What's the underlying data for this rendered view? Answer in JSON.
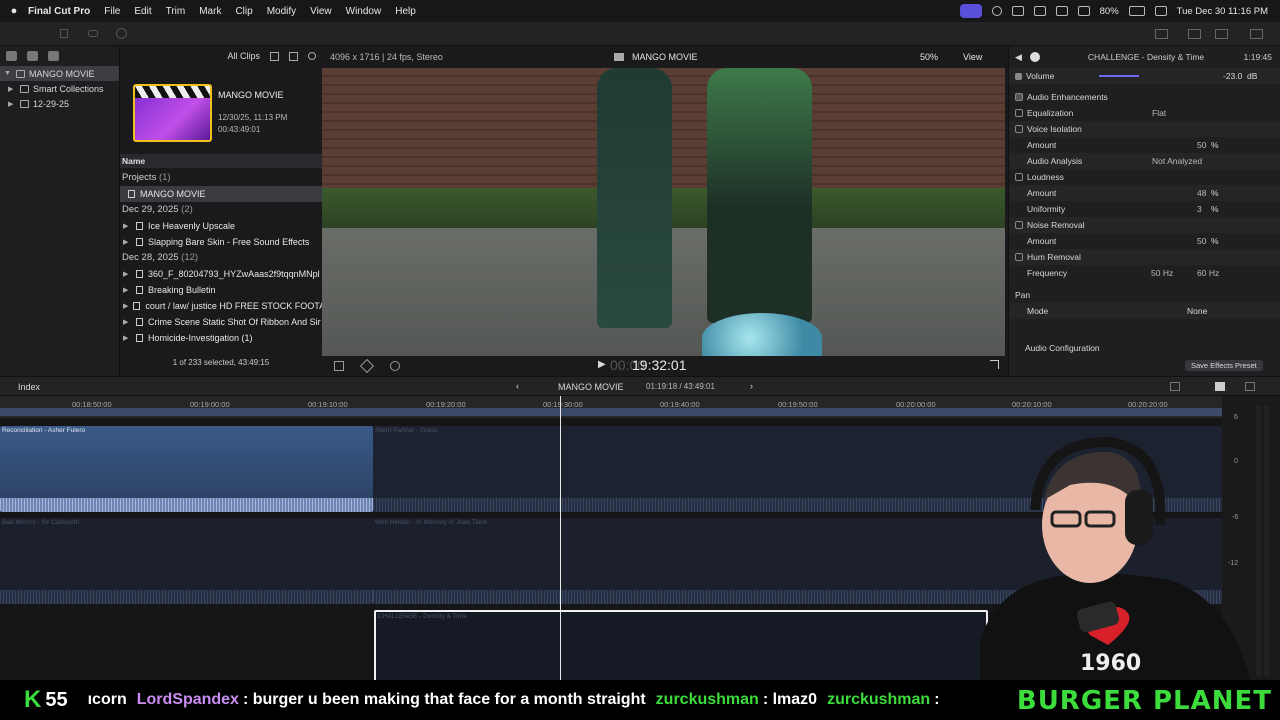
{
  "menubar": {
    "apple": "",
    "app": "Final Cut Pro",
    "items": [
      "File",
      "Edit",
      "Trim",
      "Mark",
      "Clip",
      "Modify",
      "View",
      "Window",
      "Help"
    ],
    "battery": "80%",
    "datetime": "Tue Dec 30  11:16 PM"
  },
  "library": {
    "items": [
      {
        "label": "MANGO MOVIE"
      },
      {
        "label": "Smart Collections"
      },
      {
        "label": "12-29-25"
      }
    ]
  },
  "browser": {
    "filter": "All Clips",
    "project": {
      "name": "MANGO MOVIE",
      "date": "12/30/25, 11:13 PM",
      "duration": "00:43:49:01"
    },
    "name_header": "Name",
    "groups": [
      {
        "label": "Projects",
        "count": "(1)",
        "items": [
          "MANGO MOVIE"
        ]
      },
      {
        "label": "Dec 29, 2025",
        "count": "(2)",
        "items": [
          "Ice Heavenly Upscale",
          "Slapping Bare Skin - Free Sound Effects"
        ]
      },
      {
        "label": "Dec 28, 2025",
        "count": "(12)",
        "items": [
          "360_F_80204793_HYZwAaas2f9tqqnMNpl",
          "Breaking Bulletin",
          "court / law/ justice HD FREE STOCK FOOTA",
          "Crime Scene Static Shot Of Ribbon And Sir",
          "Homicide-Investigation (1)"
        ]
      }
    ],
    "footer": "1 of 233 selected, 43:49:15"
  },
  "viewer": {
    "format": "4096 x 1716 | 24 fps, Stereo",
    "title": "MANGO MOVIE",
    "zoom": "50%",
    "view": "View",
    "timecode": "19:32:01",
    "tc_prefix": "00:00"
  },
  "inspector": {
    "title": "CHALLENGE - Density & Time",
    "time": "1:19:45",
    "volume": {
      "label": "Volume",
      "value": "-23.0",
      "unit": "dB"
    },
    "section": "Audio Enhancements",
    "rows": [
      {
        "label": "Equalization",
        "value": "Flat",
        "cb": true
      },
      {
        "label": "Voice Isolation",
        "value": "",
        "cb": true
      },
      {
        "label": "Amount",
        "value": "50",
        "unit": "%",
        "indent": true
      },
      {
        "label": "Audio Analysis",
        "value": "Not Analyzed",
        "indent": true
      },
      {
        "label": "Loudness",
        "value": "",
        "cb": true
      },
      {
        "label": "Amount",
        "value": "48",
        "unit": "%",
        "indent": true
      },
      {
        "label": "Uniformity",
        "value": "3",
        "unit": "%",
        "indent": true
      },
      {
        "label": "Noise Removal",
        "value": "",
        "cb": true
      },
      {
        "label": "Amount",
        "value": "50",
        "unit": "%",
        "indent": true
      },
      {
        "label": "Hum Removal",
        "value": "",
        "cb": true
      },
      {
        "label": "Frequency",
        "value": "50 Hz",
        "value2": "60 Hz",
        "indent": true
      }
    ],
    "pan": {
      "label": "Pan",
      "mode_label": "Mode",
      "mode_value": "None"
    },
    "config": "Audio Configuration",
    "save": "Save Effects Preset"
  },
  "timeline": {
    "index": "Index",
    "project": "MANGO MOVIE",
    "tc": "01:19:18 / 43:49:01",
    "ruler": [
      "00:18:50:00",
      "00:19:00:00",
      "00:19:10:00",
      "00:19:20:00",
      "00:19:30:00",
      "00:19:40:00",
      "00:19:50:00",
      "00:20:00:00",
      "00:20:10:00",
      "00:20:20:00"
    ],
    "clips": [
      "Reconciliation - Asher Fulero",
      "Silent Partner - Grass",
      "Bad Mirrors - Sir Cubworth",
      "Wim Heiden - In Memory of Jean Talon",
      "CHALLENGE - Density & Time"
    ],
    "meter_labels": [
      "6",
      "0",
      "-6",
      "-12"
    ]
  },
  "ticker": {
    "k": "K",
    "count": "55",
    "messages": [
      {
        "user": "ıcorn",
        "text": "",
        "color": "#ffffff"
      },
      {
        "user": "LordSpandex",
        "text": ": burger u been making that face for a month straight",
        "color": "#c98cf2"
      },
      {
        "user": "zurckushman",
        "text": ": lmaz0",
        "color": "#3ddc3d"
      },
      {
        "user": "zurckushman",
        "text": ":",
        "color": "#3ddc3d"
      }
    ],
    "brand": "BURGER PLANET"
  }
}
